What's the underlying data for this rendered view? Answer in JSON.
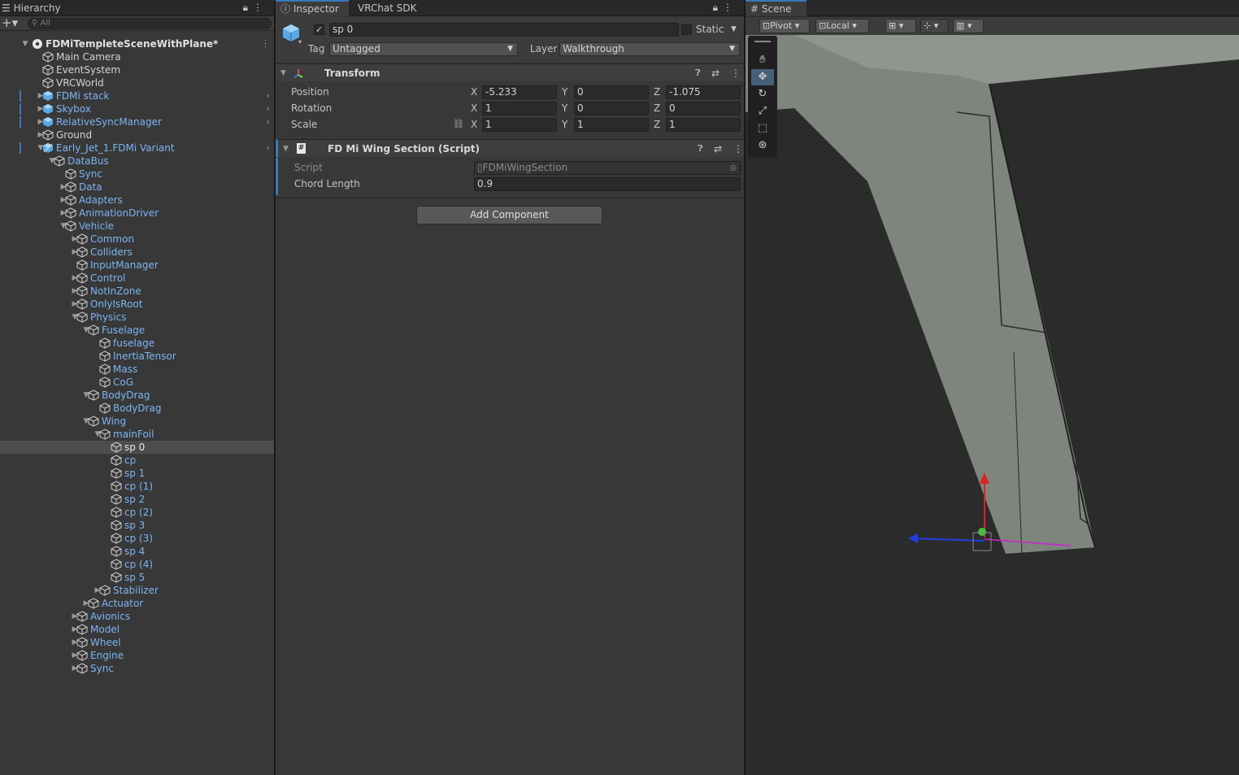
{
  "hierarchy": {
    "tab_label": "Hierarchy",
    "search_placeholder": "All",
    "rows": [
      {
        "label": "FDMiTempleteSceneWithPlane*",
        "depth": 0,
        "expanded": true,
        "kind": "scene"
      },
      {
        "label": "Main Camera",
        "depth": 1,
        "kind": "go"
      },
      {
        "label": "EventSystem",
        "depth": 1,
        "kind": "go"
      },
      {
        "label": "VRCWorld",
        "depth": 1,
        "kind": "go"
      },
      {
        "label": "FDMi stack",
        "depth": 1,
        "expanded": false,
        "kind": "prefab",
        "chevron": true,
        "mark": true
      },
      {
        "label": "Skybox",
        "depth": 1,
        "expanded": false,
        "kind": "prefab",
        "chevron": true,
        "mark": true
      },
      {
        "label": "RelativeSyncManager",
        "depth": 1,
        "expanded": false,
        "kind": "prefab",
        "chevron": true,
        "mark": true
      },
      {
        "label": "Ground",
        "depth": 1,
        "expanded": false,
        "kind": "go"
      },
      {
        "label": "Early_Jet_1.FDMi Variant",
        "depth": 1,
        "expanded": true,
        "kind": "variant",
        "chevron": true,
        "mark": true
      },
      {
        "label": "DataBus",
        "depth": 2,
        "expanded": true,
        "kind": "child"
      },
      {
        "label": "Sync",
        "depth": 3,
        "kind": "child"
      },
      {
        "label": "Data",
        "depth": 3,
        "expanded": false,
        "kind": "child"
      },
      {
        "label": "Adapters",
        "depth": 3,
        "expanded": false,
        "kind": "child"
      },
      {
        "label": "AnimationDriver",
        "depth": 3,
        "expanded": false,
        "kind": "child"
      },
      {
        "label": "Vehicle",
        "depth": 3,
        "expanded": true,
        "kind": "child"
      },
      {
        "label": "Common",
        "depth": 4,
        "expanded": false,
        "kind": "child"
      },
      {
        "label": "Colliders",
        "depth": 4,
        "expanded": false,
        "kind": "child"
      },
      {
        "label": "InputManager",
        "depth": 4,
        "kind": "child"
      },
      {
        "label": "Control",
        "depth": 4,
        "expanded": false,
        "kind": "child"
      },
      {
        "label": "NotInZone",
        "depth": 4,
        "expanded": false,
        "kind": "child"
      },
      {
        "label": "OnlyIsRoot",
        "depth": 4,
        "expanded": false,
        "kind": "child"
      },
      {
        "label": "Physics",
        "depth": 4,
        "expanded": true,
        "kind": "child"
      },
      {
        "label": "Fuselage",
        "depth": 5,
        "expanded": true,
        "kind": "child"
      },
      {
        "label": "fuselage",
        "depth": 6,
        "kind": "child"
      },
      {
        "label": "InertiaTensor",
        "depth": 6,
        "kind": "child"
      },
      {
        "label": "Mass",
        "depth": 6,
        "kind": "child"
      },
      {
        "label": "CoG",
        "depth": 6,
        "kind": "child"
      },
      {
        "label": "BodyDrag",
        "depth": 5,
        "expanded": true,
        "kind": "child"
      },
      {
        "label": "BodyDrag",
        "depth": 6,
        "kind": "child"
      },
      {
        "label": "Wing",
        "depth": 5,
        "expanded": true,
        "kind": "child"
      },
      {
        "label": "mainFoil",
        "depth": 6,
        "expanded": true,
        "kind": "child"
      },
      {
        "label": "sp 0",
        "depth": 7,
        "kind": "child",
        "selected": true
      },
      {
        "label": "cp",
        "depth": 7,
        "kind": "child"
      },
      {
        "label": "sp 1",
        "depth": 7,
        "kind": "child"
      },
      {
        "label": "cp (1)",
        "depth": 7,
        "kind": "child"
      },
      {
        "label": "sp 2",
        "depth": 7,
        "kind": "child"
      },
      {
        "label": "cp (2)",
        "depth": 7,
        "kind": "child"
      },
      {
        "label": "sp 3",
        "depth": 7,
        "kind": "child"
      },
      {
        "label": "cp (3)",
        "depth": 7,
        "kind": "child"
      },
      {
        "label": "sp 4",
        "depth": 7,
        "kind": "child"
      },
      {
        "label": "cp (4)",
        "depth": 7,
        "kind": "child"
      },
      {
        "label": "sp 5",
        "depth": 7,
        "kind": "child"
      },
      {
        "label": "Stabilizer",
        "depth": 6,
        "expanded": false,
        "kind": "child"
      },
      {
        "label": "Actuator",
        "depth": 5,
        "expanded": false,
        "kind": "child"
      },
      {
        "label": "Avionics",
        "depth": 4,
        "expanded": false,
        "kind": "child"
      },
      {
        "label": "Model",
        "depth": 4,
        "expanded": false,
        "kind": "child"
      },
      {
        "label": "Wheel",
        "depth": 4,
        "expanded": false,
        "kind": "child"
      },
      {
        "label": "Engine",
        "depth": 4,
        "expanded": false,
        "kind": "child"
      },
      {
        "label": "Sync",
        "depth": 4,
        "expanded": false,
        "kind": "child"
      }
    ]
  },
  "inspector": {
    "tab_label": "Inspector",
    "tab2_label": "VRChat SDK",
    "object_name": "sp 0",
    "static_label": "Static",
    "tag_label": "Tag",
    "tag_value": "Untagged",
    "layer_label": "Layer",
    "layer_value": "Walkthrough",
    "transform": {
      "title": "Transform",
      "position_label": "Position",
      "rotation_label": "Rotation",
      "scale_label": "Scale",
      "x": "X",
      "y": "Y",
      "z": "Z",
      "position": [
        "-5.233",
        "0",
        "-1.075"
      ],
      "rotation": [
        "1",
        "0",
        "0"
      ],
      "scale": [
        "1",
        "1",
        "1"
      ]
    },
    "script_component": {
      "title": "FD Mi Wing Section (Script)",
      "script_label": "Script",
      "script_value": "FDMiWingSection",
      "chord_label": "Chord Length",
      "chord_value": "0.9"
    },
    "add_component_label": "Add Component"
  },
  "scene": {
    "tab_label": "Scene",
    "pivot_label": "Pivot",
    "local_label": "Local"
  },
  "colors": {
    "accent": "#3a79bb",
    "prefab_text": "#7cb5f3",
    "panel_bg": "#383838"
  }
}
